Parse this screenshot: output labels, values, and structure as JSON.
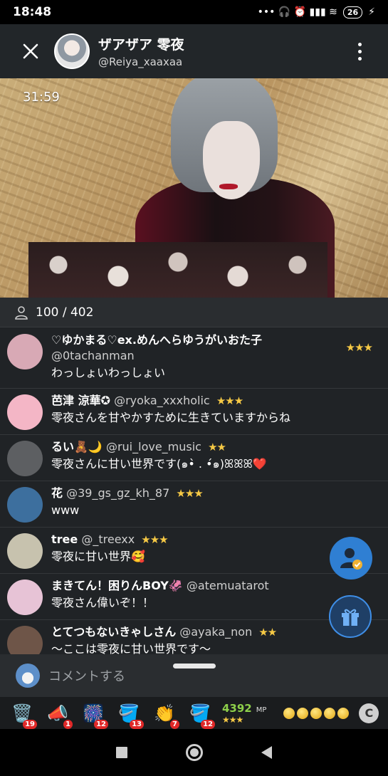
{
  "status_bar": {
    "time": "18:48",
    "icons": "••• 🎧 ⏰ ▮▮▮ ≋",
    "battery": "26",
    "charging": "⚡"
  },
  "header": {
    "name": "ザアザア 零夜",
    "handle": "@Reiya_xaaxaa"
  },
  "video": {
    "timer": "31:59"
  },
  "viewers": {
    "text": "100 / 402"
  },
  "chat": {
    "messages": [
      {
        "name": "♡ゆかまる♡ex.めんへらゆうがいおた子",
        "handle": "@0tachanman",
        "rank": "★★★",
        "text": "わっしょいわっしょい",
        "avatar_color": "#d8a9b5"
      },
      {
        "name": "芭津 涼華✪",
        "handle": "@ryoka_xxxholic",
        "rank": "★★★",
        "text": "零夜さんを甘やかすために生きていますからね",
        "avatar_color": "#f4b6c6"
      },
      {
        "name": "るい🧸🌙",
        "handle": "@rui_love_music",
        "rank": "★★",
        "text": "零夜さんに甘い世界です(๑•̀ . •́๑)ꕤꕤꕤ❤️",
        "avatar_color": "#5d5f62"
      },
      {
        "name": "花",
        "handle": "@39_gs_gz_kh_87",
        "rank": "★★★",
        "text": "www",
        "avatar_color": "#3d6f9e"
      },
      {
        "name": "tree",
        "handle": "@_treexx",
        "rank": "★★★",
        "text": "零夜に甘い世界🥰",
        "avatar_color": "#c7c2ae"
      },
      {
        "name": "まきてん！困りんBOY🦑",
        "handle": "@atemuatarot",
        "rank": "",
        "text": "零夜さん偉いぞ！！",
        "avatar_color": "#e7c3d6"
      },
      {
        "name": "とてつもないきゃしさん",
        "handle": "@ayaka_non",
        "rank": "★★",
        "text": "〜ここは零夜に甘い世界です〜",
        "avatar_color": "#6e5548"
      }
    ]
  },
  "comment": {
    "placeholder": "コメントする"
  },
  "gifts": [
    {
      "icon": "🗑️",
      "count": "19"
    },
    {
      "icon": "📣",
      "count": "1"
    },
    {
      "icon": "🎆",
      "count": "12"
    },
    {
      "icon": "🪣",
      "count": "13"
    },
    {
      "icon": "👏",
      "count": "7"
    },
    {
      "icon": "🪣",
      "count": "12"
    }
  ],
  "mp": {
    "value": "4392",
    "unit": "MP",
    "stars": "★★★"
  },
  "c_button": "C",
  "colors": {
    "accent_blue": "#2f7fd3",
    "rank_gold": "#f6c945",
    "mp_green": "#8ed04a",
    "badge_red": "#e02828"
  }
}
